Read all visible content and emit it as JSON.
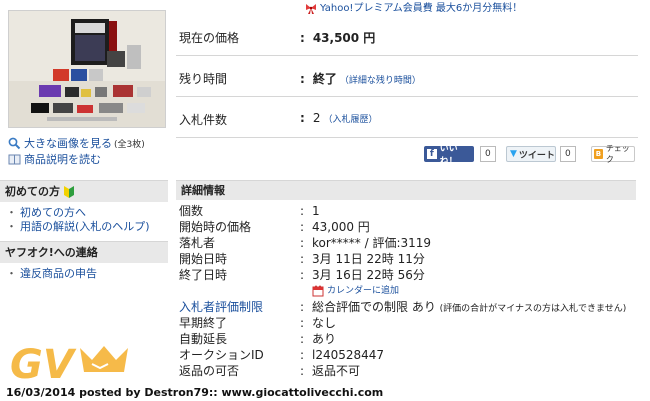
{
  "promo": {
    "text": "Yahoo!プレミアム会員費 最大6か月分無料！"
  },
  "image_links": {
    "large_image": "大きな画像を見る",
    "large_image_count": "(全3枚)",
    "description": "商品説明を読む"
  },
  "summary": {
    "price_label": "現在の価格",
    "price_value": "43,500 円",
    "time_label": "残り時間",
    "time_value": "終了",
    "time_link": "（詳細な残り時間）",
    "bids_label": "入札件数",
    "bids_value": "2",
    "bids_link": "（入札履歴）"
  },
  "social": {
    "like_label": "いいね！",
    "like_count": "0",
    "tweet_label": "ツイート",
    "tweet_count": "0",
    "check_label": "チェック"
  },
  "sidebar": {
    "beginner_title": "初めての方",
    "beginner_items": [
      "初めての方へ",
      "用語の解説(入札のヘルプ)"
    ],
    "contact_title": "ヤフオク!への連絡",
    "contact_items": [
      "違反商品の申告"
    ]
  },
  "detail": {
    "title": "詳細情報",
    "rows": [
      {
        "key": "個数",
        "value": "1"
      },
      {
        "key": "開始時の価格",
        "value": "43,000 円"
      },
      {
        "key": "落札者",
        "value": "kor***** / 評価:3119"
      },
      {
        "key": "開始日時",
        "value": "3月 11日 22時 11分"
      },
      {
        "key": "終了日時",
        "value": "3月 16日 22時 56分"
      }
    ],
    "calendar_link": "カレンダーに追加",
    "rows2": [
      {
        "key": "入札者評価制限",
        "value": "総合評価での制限 あり",
        "note": "(評価の合計がマイナスの方は入札できません)"
      },
      {
        "key": "早期終了",
        "value": "なし"
      },
      {
        "key": "自動延長",
        "value": "あり"
      },
      {
        "key": "オークションID",
        "value": "l240528447"
      },
      {
        "key": "返品の可否",
        "value": "返品不可"
      }
    ]
  },
  "watermark": {
    "logo_text": "GV"
  },
  "footer": {
    "text": "16/03/2014 posted by Destron79:: www.giocattolivecchi.com"
  },
  "colors": {
    "link": "#1a4f9c",
    "header_bg": "#e8e8e8",
    "watermark": "#f5b335"
  }
}
